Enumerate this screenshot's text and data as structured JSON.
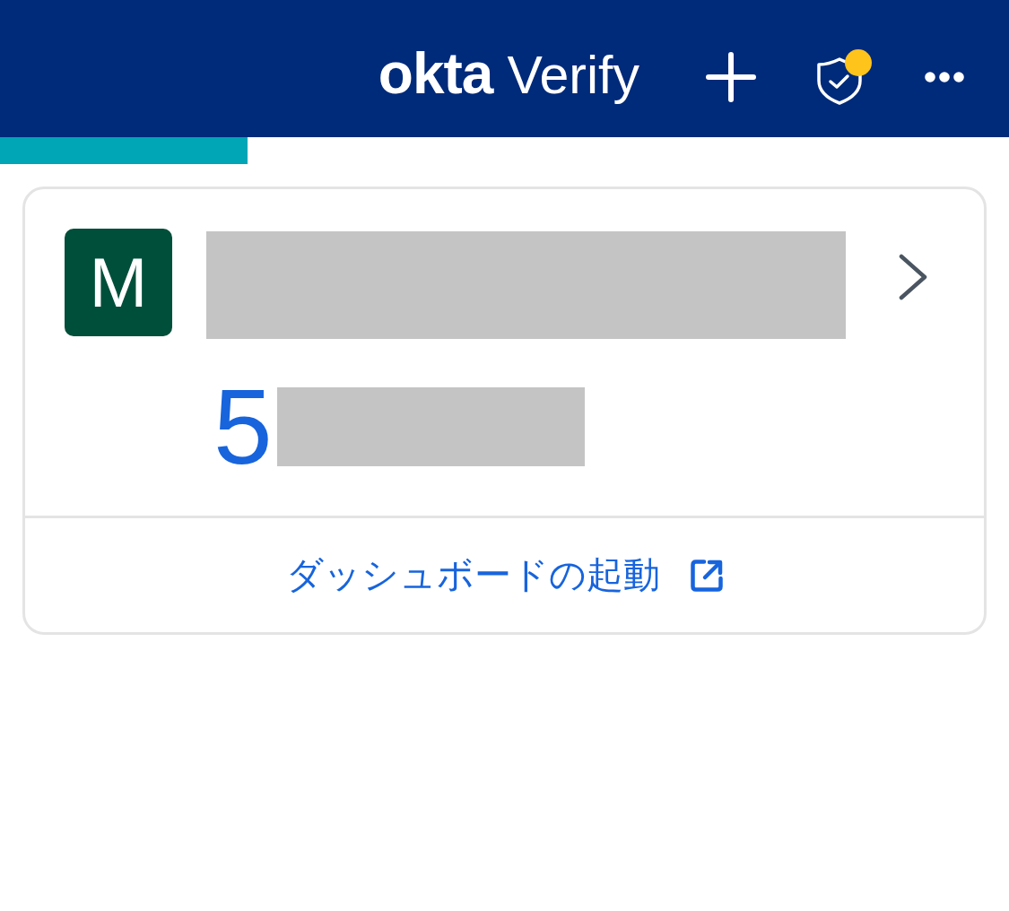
{
  "header": {
    "logo": "okta",
    "title": "Verify",
    "security_alert": true
  },
  "timer": {
    "level": 0.245
  },
  "accounts": [
    {
      "avatar_letter": "M",
      "code": "5",
      "launch_link": "ダッシュボードの起動"
    }
  ]
}
